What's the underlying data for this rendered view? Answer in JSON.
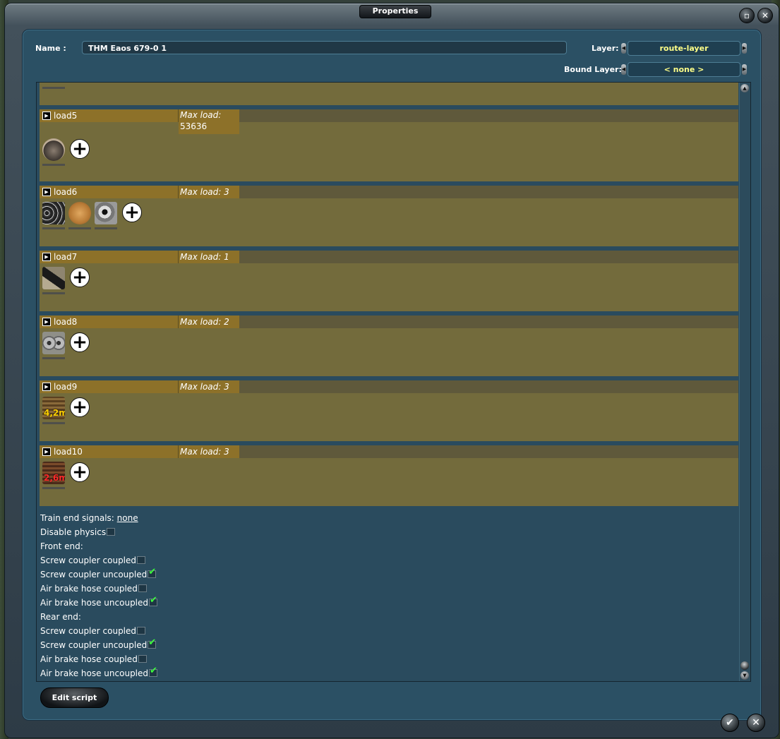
{
  "window": {
    "title": "Properties"
  },
  "header": {
    "name_label": "Name :",
    "name_value": "THM Eaos 679-0 1",
    "layer_label": "Layer:",
    "layer_value": "route-layer",
    "bound_layer_label": "Bound Layer:",
    "bound_layer_value": "< none >"
  },
  "loads": [
    {
      "name": "load5",
      "max_label": "Max load:",
      "max_value": "53636",
      "icons": [
        "rock-load-icon"
      ]
    },
    {
      "name": "load6",
      "max_label": "Max load:",
      "max_value": "3",
      "icons": [
        "pipes-load-icon",
        "wood-load-icon",
        "coil-load-icon"
      ]
    },
    {
      "name": "load7",
      "max_label": "Max load:",
      "max_value": "1",
      "icons": [
        "tube-load-icon"
      ]
    },
    {
      "name": "load8",
      "max_label": "Max load:",
      "max_value": "2",
      "icons": [
        "coils-load-icon"
      ]
    },
    {
      "name": "load9",
      "max_label": "Max load:",
      "max_value": "3",
      "icons": [
        "timber-4-2m-load-icon"
      ]
    },
    {
      "name": "load10",
      "max_label": "Max load:",
      "max_value": "3",
      "icons": [
        "timber-2-6m-load-icon"
      ]
    }
  ],
  "thumb_text": {
    "t42": "4,2m",
    "t26": "2,6m"
  },
  "properties": {
    "train_end_signals_label": "Train end signals:",
    "train_end_signals_value": "none",
    "disable_physics": "Disable physics",
    "front_end": "Front end:",
    "screw_coupled": "Screw coupler coupled",
    "screw_uncoupled": "Screw coupler uncoupled",
    "air_coupled": "Air brake hose coupled",
    "air_uncoupled": "Air brake hose uncoupled",
    "rear_end": "Rear end:"
  },
  "checks": {
    "disable_physics": false,
    "front_screw_coupled": false,
    "front_screw_uncoupled": true,
    "front_air_coupled": false,
    "front_air_uncoupled": true,
    "rear_screw_coupled": false,
    "rear_screw_uncoupled": true,
    "rear_air_coupled": false,
    "rear_air_uncoupled": true
  },
  "buttons": {
    "edit_script": "Edit script"
  },
  "colors": {
    "panel": "#2b5064",
    "load_box": "#736b3c",
    "load_header": "#8d7129",
    "check_green": "#3dff3d",
    "layer_text": "#ffff88"
  }
}
